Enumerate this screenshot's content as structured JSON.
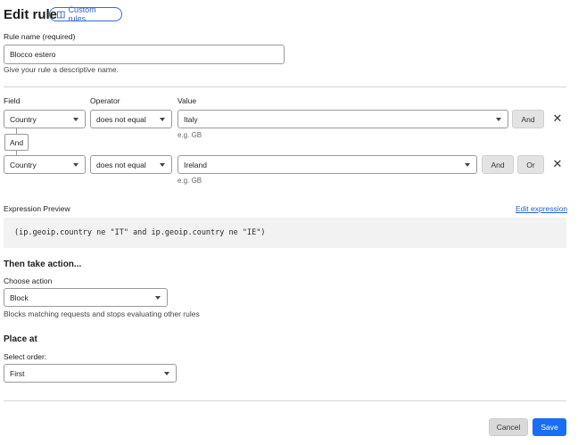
{
  "header": {
    "title": "Edit rule",
    "custom_rules_label": "Custom rules"
  },
  "rule_name": {
    "label": "Rule name (required)",
    "value": "Blocco estero",
    "help": "Give your rule a descriptive name."
  },
  "columns": {
    "field": "Field",
    "operator": "Operator",
    "value": "Value"
  },
  "conditions": [
    {
      "field": "Country",
      "operator": "does not equal",
      "value": "Italy",
      "hint": "e.g. GB"
    },
    {
      "field": "Country",
      "operator": "does not equal",
      "value": "Ireland",
      "hint": "e.g. GB"
    }
  ],
  "logic": {
    "and": "And",
    "or": "Or",
    "connector": "And"
  },
  "expression": {
    "label": "Expression Preview",
    "edit_link": "Edit expression",
    "text": "(ip.geoip.country ne \"IT\" and ip.geoip.country ne \"IE\")"
  },
  "action": {
    "heading": "Then take action...",
    "label": "Choose action",
    "value": "Block",
    "help": "Blocks matching requests and stops evaluating other rules"
  },
  "place": {
    "heading": "Place at",
    "label": "Select order:",
    "value": "First"
  },
  "footer": {
    "cancel": "Cancel",
    "save": "Save"
  },
  "colors": {
    "accent": "#1a6ef5",
    "link": "#1f5fcf"
  }
}
